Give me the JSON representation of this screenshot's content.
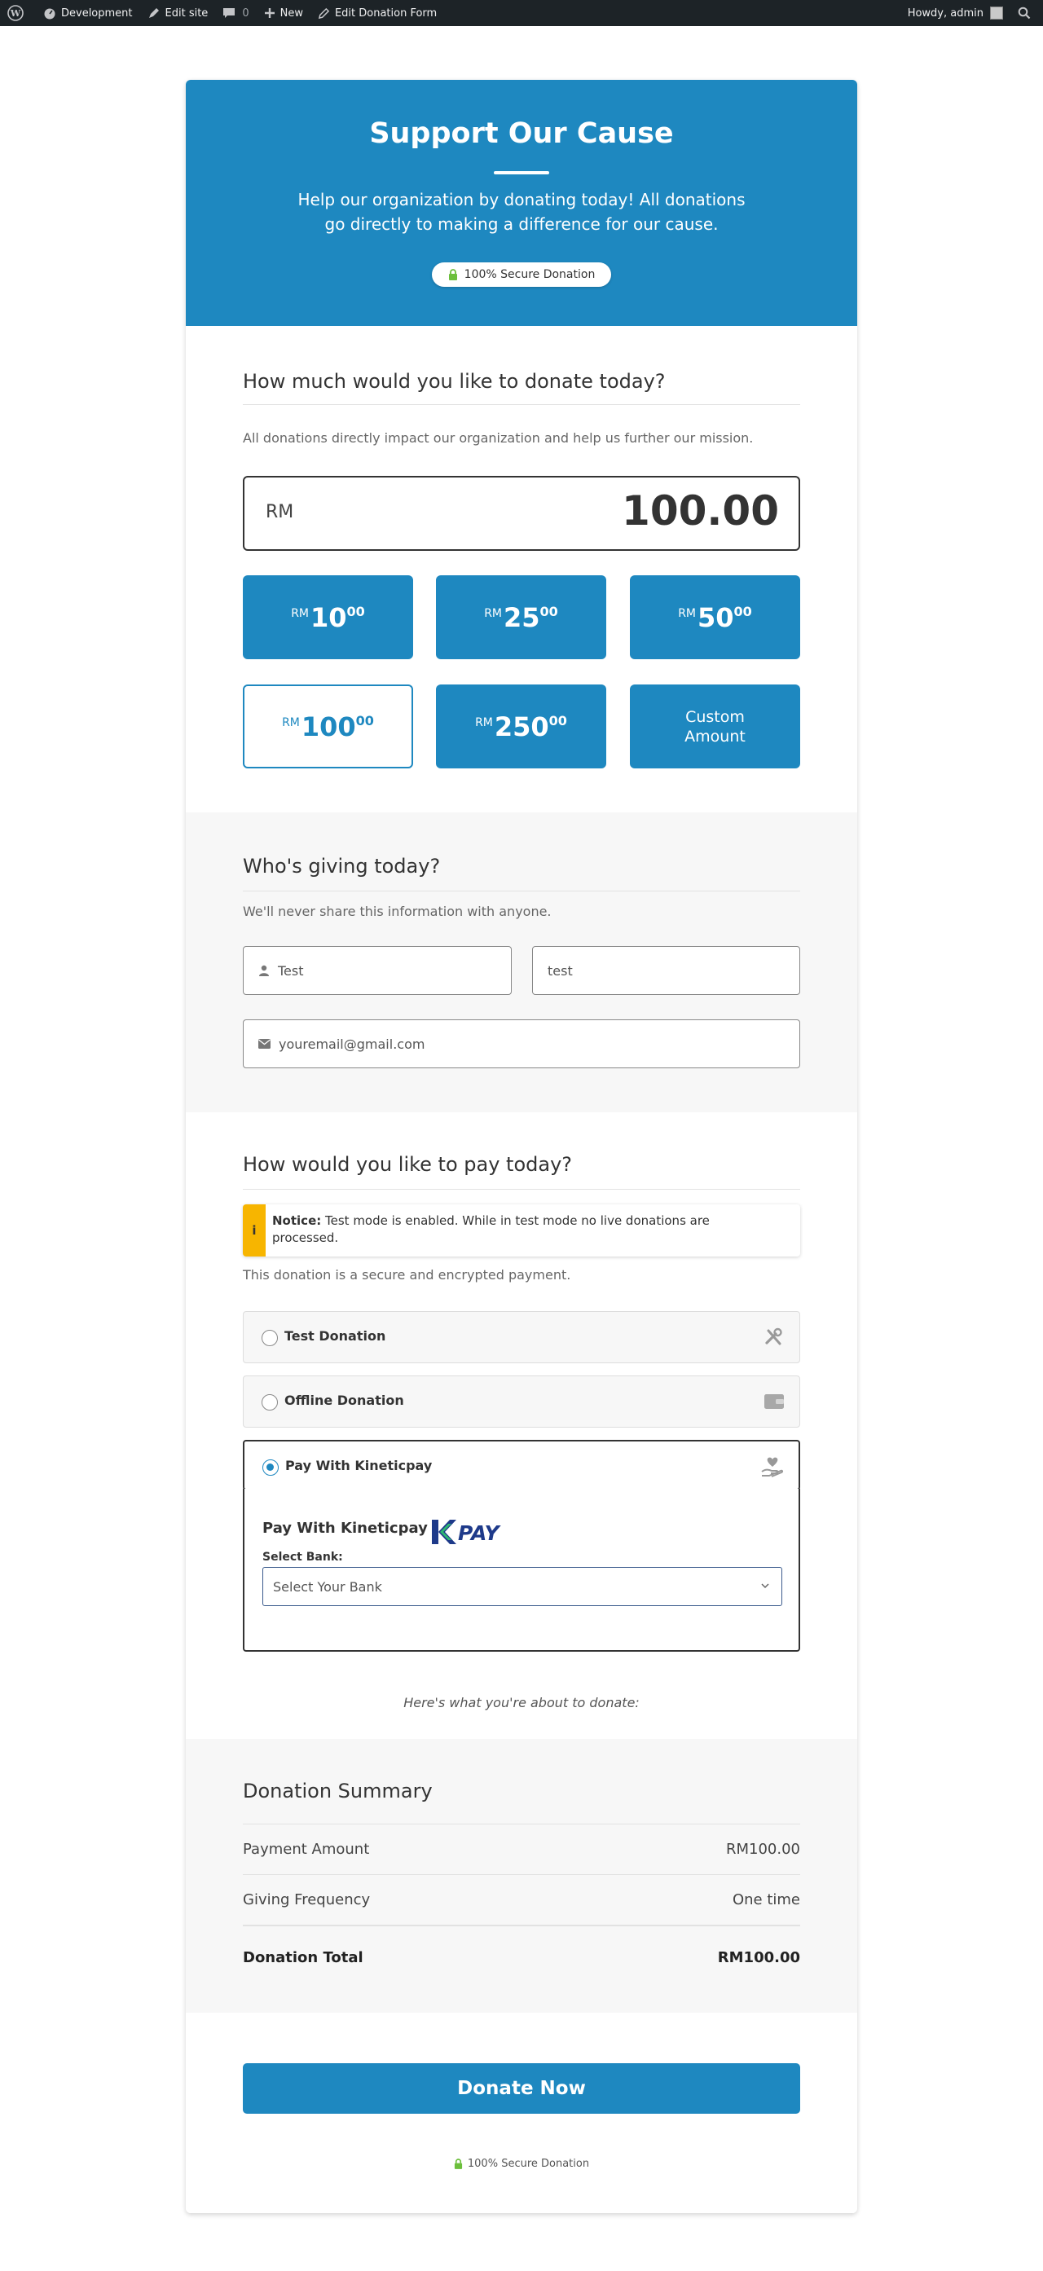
{
  "adminbar": {
    "site_name": "Development",
    "edit_site": "Edit site",
    "comments_count": "0",
    "new_label": "New",
    "edit_form": "Edit Donation Form",
    "howdy": "Howdy, admin"
  },
  "header": {
    "title": "Support Our Cause",
    "description": "Help our organization by donating today! All donations go directly to making a difference for our cause.",
    "secure_badge": "100% Secure Donation"
  },
  "amount_section": {
    "title": "How much would you like to donate today?",
    "subtitle": "All donations directly impact our organization and help us further our mission.",
    "currency": "RM",
    "amount_value": "100.00",
    "levels": [
      {
        "currency": "RM",
        "main": "10",
        "decimals": "00",
        "selected": false
      },
      {
        "currency": "RM",
        "main": "25",
        "decimals": "00",
        "selected": false
      },
      {
        "currency": "RM",
        "main": "50",
        "decimals": "00",
        "selected": false
      },
      {
        "currency": "RM",
        "main": "100",
        "decimals": "00",
        "selected": true
      },
      {
        "currency": "RM",
        "main": "250",
        "decimals": "00",
        "selected": false
      }
    ],
    "custom_amount_line1": "Custom",
    "custom_amount_line2": "Amount"
  },
  "giver_section": {
    "title": "Who's giving today?",
    "subtitle": "We'll never share this information with anyone.",
    "first_name_value": "Test",
    "last_name_value": "test",
    "email_value": "youremail@gmail.com"
  },
  "payment_section": {
    "title": "How would you like to pay today?",
    "notice_label": "Notice:",
    "notice_text": "Test mode is enabled. While in test mode no live donations are processed.",
    "secure_text": "This donation is a secure and encrypted payment.",
    "gateways": [
      {
        "label": "Test Donation",
        "icon": "tools-icon",
        "selected": false
      },
      {
        "label": "Offline Donation",
        "icon": "wallet-icon",
        "selected": false
      },
      {
        "label": "Pay With Kineticpay",
        "icon": "hand-heart-icon",
        "selected": true
      }
    ],
    "panel_title": "Pay With Kineticpay",
    "logo_k": "K",
    "logo_text": "PAY",
    "select_bank_label": "Select Bank:",
    "select_bank_value": "Select Your Bank",
    "about_text": "Here's what you're about to donate:"
  },
  "summary": {
    "title": "Donation Summary",
    "rows": [
      {
        "label": "Payment Amount",
        "value": "RM100.00"
      },
      {
        "label": "Giving Frequency",
        "value": "One time"
      }
    ],
    "total_label": "Donation Total",
    "total_value": "RM100.00"
  },
  "submit": {
    "button_label": "Donate Now",
    "secure_text": "100% Secure Donation"
  },
  "colors": {
    "primary": "#1e88c0",
    "notice": "#f7b500",
    "adminbar": "#1d2327",
    "lock": "#6cbf3c"
  }
}
